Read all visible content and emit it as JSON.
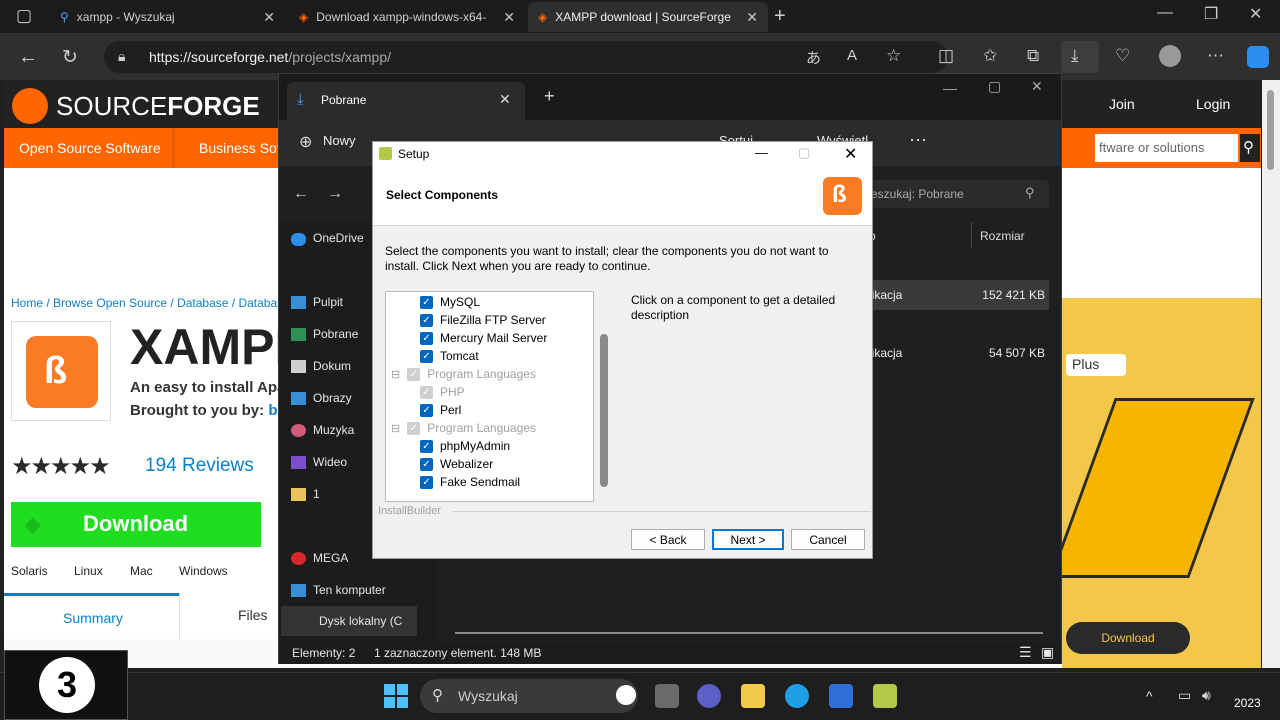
{
  "browser": {
    "tabs": [
      {
        "label": "xampp - Wyszukaj",
        "icon": "search-icon"
      },
      {
        "label": "Download xampp-windows-x64-",
        "icon": "sourceforge-icon"
      },
      {
        "label": "XAMPP download | SourceForge",
        "icon": "sourceforge-icon"
      }
    ],
    "url_main": "https://sourceforge.net",
    "url_path": "/projects/xampp/"
  },
  "sourceforge": {
    "logo_text_a": "SOURCE",
    "logo_text_b": "FORGE",
    "join": "Join",
    "login": "Login",
    "search_placeholder": "ftware or solutions",
    "nav": [
      "Open Source Software",
      "Business Sof"
    ],
    "breadcrumb": "Home / Browse Open Source / Database / Database",
    "project_title": "XAMPP",
    "tagline1": "An easy to install Apa",
    "tagline2": "Brought to you by:",
    "tagline2_link": "be",
    "stars": "★★★★★",
    "reviews": "194 Reviews",
    "download": "Download",
    "os": [
      "Solaris",
      "Linux",
      "Mac",
      "Windows"
    ],
    "page_tabs": [
      "Summary",
      "Files"
    ],
    "ad_plus": "Plus",
    "ad_download": "Download"
  },
  "explorer": {
    "tab_title": "Pobrane",
    "new_label": "Nowy",
    "sort_label": "Sortuj",
    "view_label": "Wyświetl",
    "search_placeholder": "eszukaj: Pobrane",
    "column_size": "Rozmiar",
    "column_type": "o",
    "sidebar": [
      "OneDrive",
      "Pulpit",
      "Pobrane",
      "Dokum",
      "Obrazy",
      "Muzyka",
      "Wideo",
      "1",
      "MEGA",
      "Ten komputer",
      "Dysk lokalny (C"
    ],
    "rows": [
      {
        "type": "likacja",
        "size": "152 421 KB"
      },
      {
        "type": "likacja",
        "size": "54 507 KB"
      }
    ],
    "status_items": "Elementy: 2",
    "status_selected": "1 zaznaczony element. 148 MB"
  },
  "setup": {
    "title": "Setup",
    "heading": "Select Components",
    "instruction": "Select the components you want to install; clear the components you do not want to install. Click Next when you are ready to continue.",
    "description": "Click on a component to get a detailed description",
    "tree": [
      {
        "label": "MySQL",
        "disabled": false,
        "group": false
      },
      {
        "label": "FileZilla FTP Server",
        "disabled": false,
        "group": false
      },
      {
        "label": "Mercury Mail Server",
        "disabled": false,
        "group": false
      },
      {
        "label": "Tomcat",
        "disabled": false,
        "group": false
      },
      {
        "label": "Program Languages",
        "disabled": true,
        "group": true
      },
      {
        "label": "PHP",
        "disabled": true,
        "group": false
      },
      {
        "label": "Perl",
        "disabled": false,
        "group": false
      },
      {
        "label": "Program Languages",
        "disabled": true,
        "group": true
      },
      {
        "label": "phpMyAdmin",
        "disabled": false,
        "group": false
      },
      {
        "label": "Webalizer",
        "disabled": false,
        "group": false
      },
      {
        "label": "Fake Sendmail",
        "disabled": false,
        "group": false
      }
    ],
    "footer_brand": "InstallBuilder",
    "back": "< Back",
    "next": "Next >",
    "cancel": "Cancel"
  },
  "taskbar": {
    "search": "Wyszukaj",
    "year": "2023",
    "badge": "3"
  }
}
